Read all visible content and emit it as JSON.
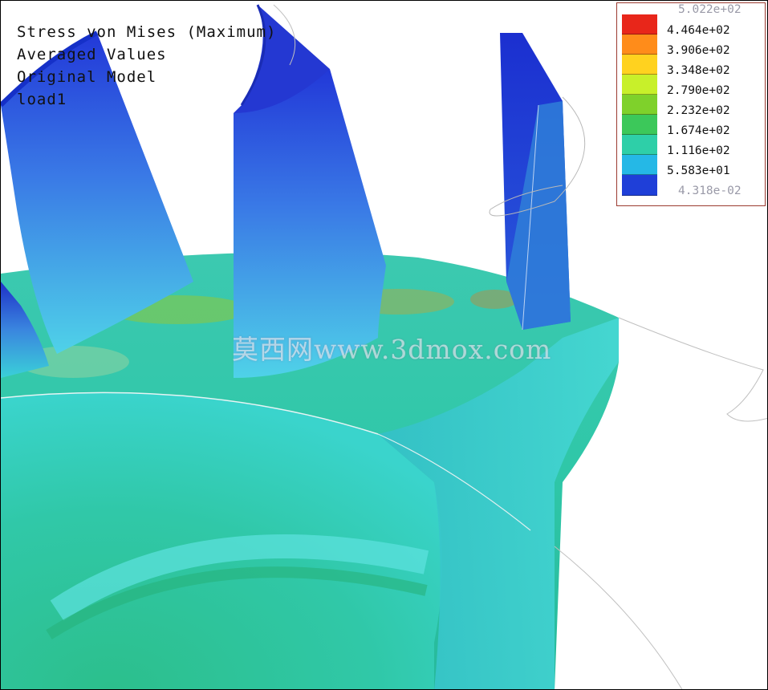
{
  "header": {
    "result_type": "Stress von Mises (Maximum)",
    "value_mode": "Averaged Values",
    "model_state": "Original Model",
    "load_case": "load1"
  },
  "legend": {
    "max_value": "5.022e+02",
    "min_value": "4.318e-02",
    "bands": [
      {
        "label": "4.464e+02",
        "color": "#e8261a"
      },
      {
        "label": "3.906e+02",
        "color": "#ff8c1a"
      },
      {
        "label": "3.348e+02",
        "color": "#ffd21f"
      },
      {
        "label": "2.790e+02",
        "color": "#c8f02a"
      },
      {
        "label": "2.232e+02",
        "color": "#7fd12b"
      },
      {
        "label": "1.674e+02",
        "color": "#3cc85a"
      },
      {
        "label": "1.116e+02",
        "color": "#2ecfa8"
      },
      {
        "label": "5.583e+01",
        "color": "#25b8e6"
      },
      {
        "label": "",
        "color": "#1f3fd8"
      }
    ]
  },
  "watermark": "莫西网www.3dmox.com"
}
